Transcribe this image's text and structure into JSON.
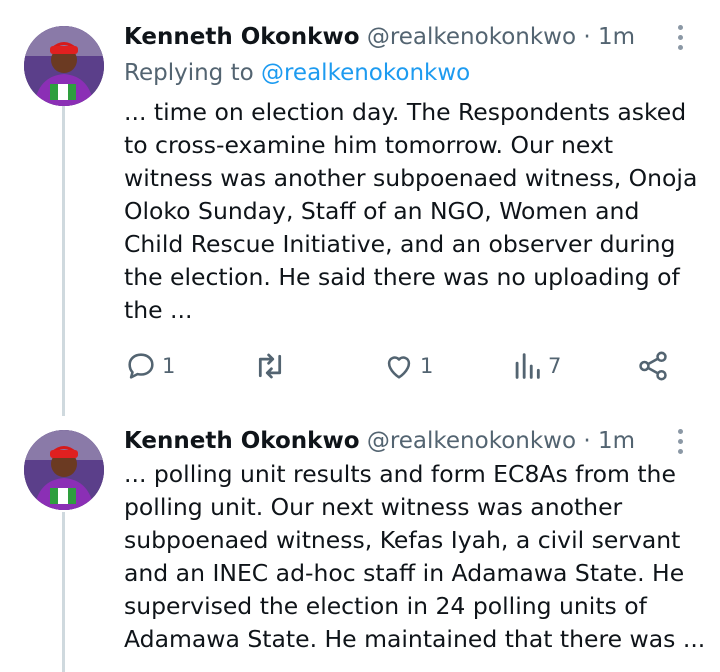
{
  "tweets": [
    {
      "name": "Kenneth Okonkwo",
      "handle": "@realkenokonkwo",
      "separator": "·",
      "time": "1m",
      "reply_prefix": "Replying to",
      "reply_handle": "@realkenokonkwo",
      "text": "... time on election day. The Respondents asked\nto cross-examine him tomorrow. Our next\nwitness was another subpoenaed witness, Onoja\nOloko Sunday, Staff of an NGO, Women and\nChild Rescue Initiative, and an observer during\nthe election. He said there was no uploading of\nthe ...",
      "actions": {
        "replies": "1",
        "retweets": "",
        "likes": "1",
        "views": "7"
      },
      "icons": [
        "reply-icon",
        "retweet-icon",
        "like-icon",
        "views-icon",
        "share-icon",
        "more-icon"
      ]
    },
    {
      "name": "Kenneth Okonkwo",
      "handle": "@realkenokonkwo",
      "separator": "·",
      "time": "1m",
      "text": "... polling unit results and form EC8As from the\npolling unit. Our next witness was another\nsubpoenaed witness, Kefas Iyah, a civil servant\nand an INEC ad-hoc staff in Adamawa State. He\nsupervised the election in 24 polling units of\nAdamawa State. He maintained that there was ..."
    }
  ],
  "colors": {
    "text": "#0f1419",
    "secondary": "#536471",
    "link": "#1d9bf0",
    "thread_line": "#cfd9de"
  }
}
